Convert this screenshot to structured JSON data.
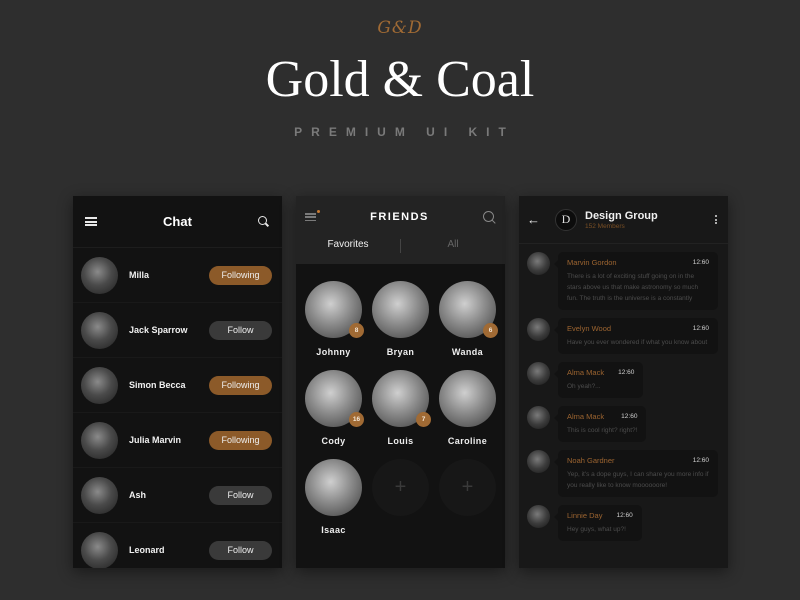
{
  "header": {
    "logo_mark": "G&D",
    "title": "Gold & Coal",
    "subtitle": "PREMIUM UI KIT"
  },
  "colors": {
    "accent": "#8c5a29",
    "background": "#2e2e2e",
    "panel": "#121212"
  },
  "chat_screen": {
    "title": "Chat",
    "menu_icon": "hamburger-icon",
    "search_icon": "search-icon",
    "contacts": [
      {
        "name": "Milla",
        "button": "Following",
        "state": "following"
      },
      {
        "name": "Jack Sparrow",
        "button": "Follow",
        "state": "follow"
      },
      {
        "name": "Simon Becca",
        "button": "Following",
        "state": "following"
      },
      {
        "name": "Julia Marvin",
        "button": "Following",
        "state": "following"
      },
      {
        "name": "Ash",
        "button": "Follow",
        "state": "follow"
      },
      {
        "name": "Leonard",
        "button": "Follow",
        "state": "follow"
      }
    ]
  },
  "friends_screen": {
    "title": "FRIENDS",
    "tabs": [
      {
        "label": "Favorites",
        "active": true
      },
      {
        "label": "All",
        "active": false
      }
    ],
    "friends": [
      {
        "name": "Johnny",
        "badge": "8"
      },
      {
        "name": "Bryan",
        "badge": null
      },
      {
        "name": "Wanda",
        "badge": "6"
      },
      {
        "name": "Cody",
        "badge": "16"
      },
      {
        "name": "Louis",
        "badge": "7"
      },
      {
        "name": "Caroline",
        "badge": null
      },
      {
        "name": "Isaac",
        "badge": null
      }
    ],
    "add_slot_label": "+"
  },
  "group_screen": {
    "back_icon": "←",
    "group_initial": "D",
    "group_name": "Design Group",
    "members": "152 Members",
    "messages": [
      {
        "name": "Marvin Gordon",
        "time": "12:60",
        "text": "There is a lot of exciting stuff going on in the stars above us that make astronomy so much fun. The truth is the universe is a constantly"
      },
      {
        "name": "Evelyn Wood",
        "time": "12:60",
        "text": "Have you ever wondered if what you know about"
      },
      {
        "name": "Alma Mack",
        "time": "12:60",
        "text": "Oh yeah?..."
      },
      {
        "name": "Alma Mack",
        "time": "12:60",
        "text": "This is cool right? right?!"
      },
      {
        "name": "Noah Gardner",
        "time": "12:60",
        "text": "Yep, it's a dope guys, I can share you more info if you really like to know moooooore!"
      },
      {
        "name": "Linnie Day",
        "time": "12:60",
        "text": "Hey guys, what up?!"
      }
    ]
  }
}
